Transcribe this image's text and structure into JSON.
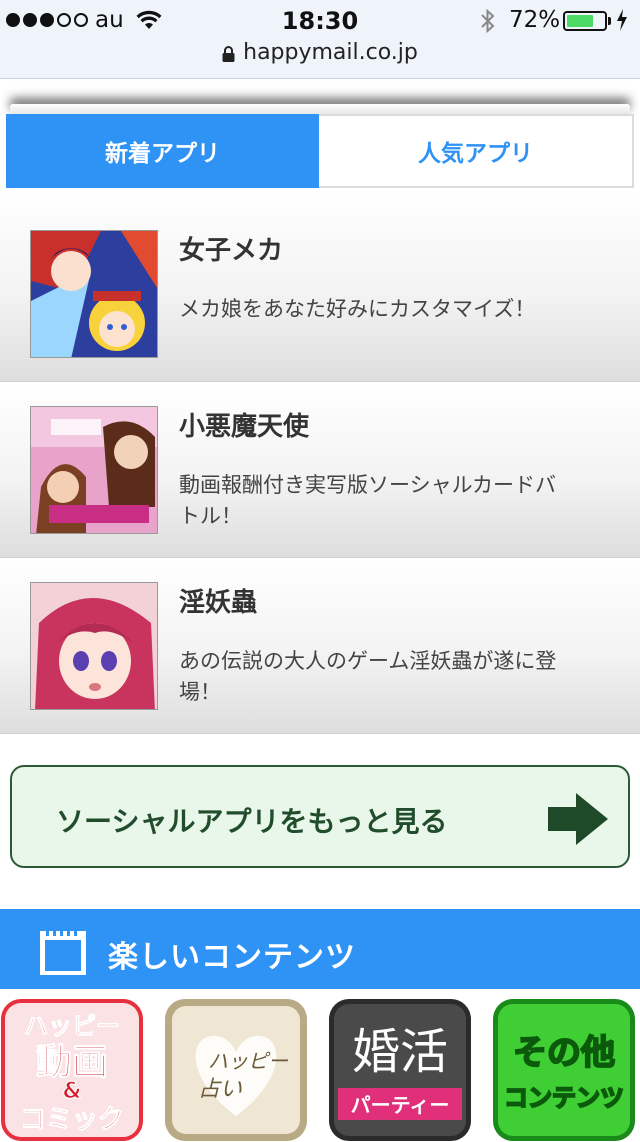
{
  "status_bar": {
    "carrier": "au",
    "time": "18:30",
    "battery_percent": "72%",
    "battery_level": 0.72,
    "signal_bars_filled": 3,
    "signal_bars_total": 5,
    "url": "happymail.co.jp"
  },
  "tabs": [
    {
      "label": "新着アプリ",
      "active": true
    },
    {
      "label": "人気アプリ",
      "active": false
    }
  ],
  "apps": [
    {
      "name": "女子メカ",
      "description": "メカ娘をあなた好みにカスタマイズ！"
    },
    {
      "name": "小悪魔天使",
      "description": "動画報酬付き実写版ソーシャルカードバトル！"
    },
    {
      "name": "淫妖蟲",
      "description": "あの伝説の大人のゲーム淫妖蟲が遂に登場！"
    }
  ],
  "more_button": {
    "label": "ソーシャルアプリをもっと見る"
  },
  "section": {
    "title": "楽しいコンテンツ"
  },
  "content_icons": [
    {
      "icon": "happy-video-comic-icon",
      "lines": [
        "ハッピー",
        "動画",
        "&",
        "コミック"
      ]
    },
    {
      "icon": "happy-fortune-icon",
      "lines": [
        "ハッピー",
        "占い"
      ]
    },
    {
      "icon": "konkatsu-party-icon",
      "lines": [
        "婚活",
        "パーティー"
      ]
    },
    {
      "icon": "other-contents-icon",
      "lines": [
        "その他",
        "コンテンツ"
      ]
    }
  ],
  "colors": {
    "accent_blue": "#2e93f5",
    "button_green_bg": "#e8f7e9",
    "button_green_text": "#214d2c",
    "battery_green": "#4cd964"
  }
}
